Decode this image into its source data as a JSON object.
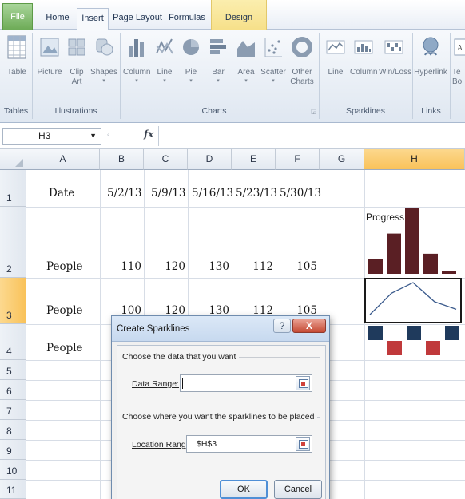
{
  "ribbon": {
    "tabs": [
      {
        "label": "File"
      },
      {
        "label": "Home"
      },
      {
        "label": "Insert"
      },
      {
        "label": "Page Layout"
      },
      {
        "label": "Formulas"
      },
      {
        "label": "Design"
      }
    ],
    "buttons": {
      "table": "Table",
      "picture": "Picture",
      "clip_art_1": "Clip",
      "clip_art_2": "Art",
      "shapes": "Shapes",
      "column": "Column",
      "line": "Line",
      "pie": "Pie",
      "bar": "Bar",
      "area": "Area",
      "scatter": "Scatter",
      "other_charts_1": "Other",
      "other_charts_2": "Charts",
      "spark_line": "Line",
      "spark_column": "Column",
      "spark_winloss": "Win/Loss",
      "hyperlink": "Hyperlink",
      "text_1": "Te",
      "text_2": "Bo"
    },
    "groups": {
      "tables": "Tables",
      "illustrations": "Illustrations",
      "charts": "Charts",
      "sparklines": "Sparklines",
      "links": "Links"
    }
  },
  "formula_bar": {
    "name_box": "H3",
    "fx": "fx"
  },
  "sheet": {
    "columns": [
      "A",
      "B",
      "C",
      "D",
      "E",
      "F",
      "G",
      "H"
    ],
    "selected_column": "H",
    "rows": [
      "1",
      "2",
      "3",
      "4",
      "5",
      "6",
      "7",
      "8",
      "9",
      "10",
      "11"
    ],
    "selected_row": "3",
    "row1": {
      "a": "Date",
      "b": "5/2/13",
      "c": "5/9/13",
      "d": "5/16/13",
      "e": "5/23/13",
      "f": "5/30/13"
    },
    "row2": {
      "a": "People",
      "b": "110",
      "c": "120",
      "d": "130",
      "e": "112",
      "f": "105"
    },
    "row3": {
      "a": "People",
      "b": "100",
      "c": "120",
      "d": "130",
      "e": "112",
      "f": "105"
    },
    "row4": {
      "a": "People"
    },
    "progress_label": "Progress",
    "sparklines": {
      "column_values": [
        110,
        120,
        130,
        112,
        105
      ],
      "line_values": [
        100,
        120,
        130,
        112,
        105
      ],
      "winloss_values": [
        1,
        -1,
        1,
        -1,
        1
      ],
      "column_color": "#5a1f24",
      "line_color": "#3a5a8c",
      "win_color": "#1f3a5c",
      "loss_color": "#c0393b"
    }
  },
  "dialog": {
    "title": "Create Sparklines",
    "help_glyph": "?",
    "close_glyph": "X",
    "section1": "Choose the data that you want",
    "data_range_label": "Data Range:",
    "data_range_value": "",
    "section2": "Choose where you want the sparklines to be placed",
    "location_range_label": "Location Range:",
    "location_range_value": "$H$3",
    "ok": "OK",
    "cancel": "Cancel"
  }
}
